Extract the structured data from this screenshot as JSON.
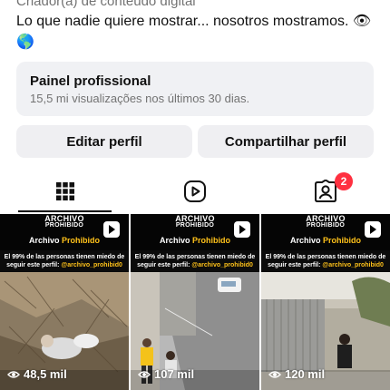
{
  "bio": {
    "category": "Criador(a) de conteúdo digital",
    "text": "Lo que nadie quiere mostrar... nosotros mostramos.",
    "emoji_1": "👁",
    "emoji_2": "🌎"
  },
  "professional_panel": {
    "title": "Painel profissional",
    "subtitle": "15,5 mi visualizações nos últimos 30 dias."
  },
  "buttons": {
    "edit_profile": "Editar perfil",
    "share_profile": "Compartilhar perfil"
  },
  "tabs": {
    "active": "grid",
    "items": [
      "grid-icon",
      "reels-icon",
      "tagged-icon"
    ],
    "tagged_badge": "2"
  },
  "posts": [
    {
      "brand_line1": "ARCHIVO",
      "brand_line2": "PROHIBIDO",
      "account_a": "Archivo",
      "account_b": "Prohibido",
      "warning_a": "El 99% de las personas tienen miedo de seguir este perfil:",
      "warning_b": "@archivo_prohibid0",
      "views": "48,5 mil"
    },
    {
      "brand_line1": "ARCHIVO",
      "brand_line2": "PROHIBIDO",
      "account_a": "Archivo",
      "account_b": "Prohibido",
      "warning_a": "El 99% de las personas tienen miedo de seguir este perfil:",
      "warning_b": "@archivo_prohibid0",
      "views": "107 mil"
    },
    {
      "brand_line1": "ARCHIVO",
      "brand_line2": "PROHIBIDO",
      "account_a": "Archivo",
      "account_b": "Prohibido",
      "warning_a": "El 99% de las personas tienen miedo de seguir este perfil:",
      "warning_b": "@archivo_prohibid0",
      "views": "120 mil"
    }
  ],
  "colors": {
    "accent_yellow": "#ffc21a",
    "badge_red": "#ff3040",
    "card_bg": "#f0f1f4"
  }
}
